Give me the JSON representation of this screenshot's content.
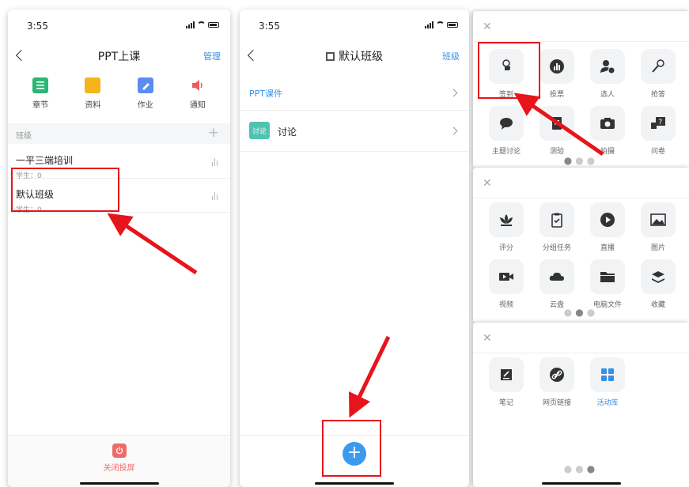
{
  "screen1": {
    "time": "3:55",
    "title": "PPT上课",
    "nav_right": "管理",
    "grid": [
      {
        "label": "章节",
        "icon": "list-icon",
        "color": "#2bb673"
      },
      {
        "label": "资料",
        "icon": "folder-icon",
        "color": "#f5b41a"
      },
      {
        "label": "作业",
        "icon": "edit-icon",
        "color": "#5b8cf0"
      },
      {
        "label": "通知",
        "icon": "speaker-icon",
        "color": "#f05a5a"
      }
    ],
    "section_label": "班级",
    "classes": [
      {
        "name": "一平三端培训",
        "students": "学生：0"
      },
      {
        "name": "默认班级",
        "students": "学生：0"
      }
    ],
    "bottom_label": "关闭投屏"
  },
  "screen2": {
    "time": "3:55",
    "title": "默认班级",
    "nav_right": "班级",
    "rows": [
      {
        "label": "PPT课件"
      },
      {
        "badge": "讨论",
        "label": "讨论"
      }
    ]
  },
  "panel1": {
    "tiles": [
      {
        "label": "签到",
        "icon": "hand-tap-icon",
        "highlight": true
      },
      {
        "label": "投票",
        "icon": "bar-chart-icon"
      },
      {
        "label": "选人",
        "icon": "person-check-icon"
      },
      {
        "label": "抢答",
        "icon": "microphone-icon"
      },
      {
        "label": "主题讨论",
        "icon": "chat-bubble-icon"
      },
      {
        "label": "测验",
        "icon": "quiz-icon"
      },
      {
        "label": "拍摄",
        "icon": "camera-icon"
      },
      {
        "label": "问卷",
        "icon": "question-icon"
      }
    ]
  },
  "panel2": {
    "tiles": [
      {
        "label": "评分",
        "icon": "lotus-icon"
      },
      {
        "label": "分组任务",
        "icon": "clipboard-check-icon"
      },
      {
        "label": "直播",
        "icon": "play-icon"
      },
      {
        "label": "图片",
        "icon": "image-icon"
      },
      {
        "label": "视频",
        "icon": "video-icon"
      },
      {
        "label": "云盘",
        "icon": "cloud-icon"
      },
      {
        "label": "电脑文件",
        "icon": "folder-icon"
      },
      {
        "label": "收藏",
        "icon": "stack-icon"
      }
    ]
  },
  "panel3": {
    "tiles": [
      {
        "label": "笔记",
        "icon": "note-icon"
      },
      {
        "label": "网页链接",
        "icon": "link-icon"
      },
      {
        "label": "活动库",
        "icon": "grid-icon",
        "accent": "#3a8ee6"
      }
    ]
  }
}
